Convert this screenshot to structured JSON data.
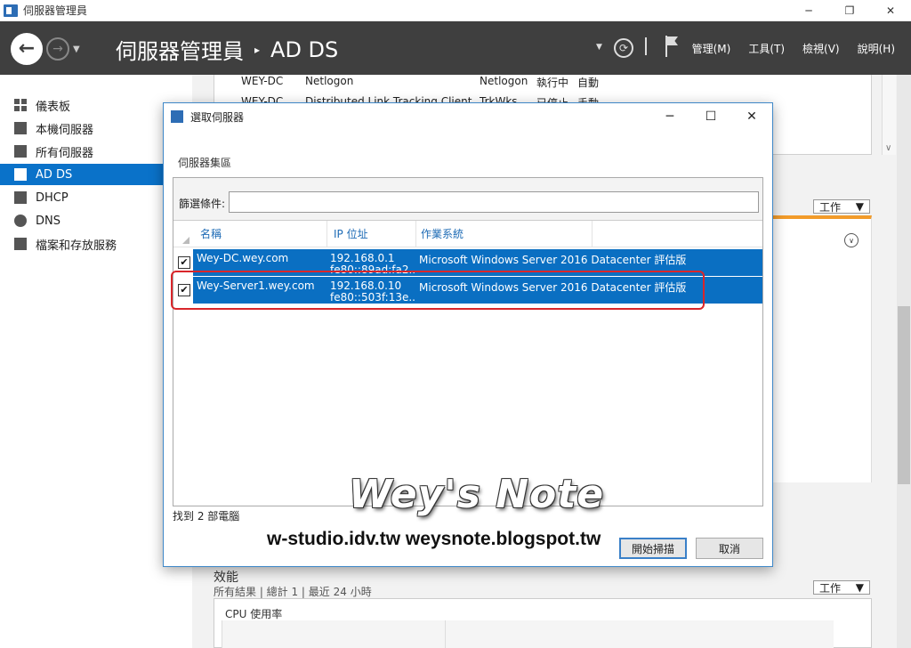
{
  "window": {
    "title": "伺服器管理員",
    "controls": [
      "─",
      "❐",
      "✕"
    ]
  },
  "header": {
    "breadcrumb_root": "伺服器管理員",
    "breadcrumb_sep": "▸",
    "breadcrumb_current": "AD DS",
    "menus": [
      "管理(M)",
      "工具(T)",
      "檢視(V)",
      "說明(H)"
    ]
  },
  "sidebar": {
    "items": [
      {
        "label": "儀表板",
        "icon": "dashboard-icon"
      },
      {
        "label": "本機伺服器",
        "icon": "server-icon"
      },
      {
        "label": "所有伺服器",
        "icon": "servers-icon"
      },
      {
        "label": "AD DS",
        "icon": "adds-icon",
        "active": true
      },
      {
        "label": "DHCP",
        "icon": "dhcp-icon"
      },
      {
        "label": "DNS",
        "icon": "dns-icon"
      },
      {
        "label": "檔案和存放服務",
        "icon": "storage-icon"
      }
    ]
  },
  "services": {
    "rows": [
      {
        "server": "WEY-DC",
        "display": "Netlogon",
        "service": "Netlogon",
        "status": "執行中",
        "start": "自動"
      },
      {
        "server": "WEY-DC",
        "display": "Distributed Link Tracking Client",
        "service": "TrkWks",
        "status": "已停止",
        "start": "手動"
      }
    ]
  },
  "tasks_label": "工作",
  "performance": {
    "title": "效能",
    "subtitle": "所有結果 | 總計 1 | 最近 24 小時",
    "cpu_label": "CPU 使用率"
  },
  "dialog": {
    "title": "選取伺服器",
    "pool_label": "伺服器集區",
    "filter_label": "篩選條件:",
    "filter_value": "",
    "columns": {
      "name": "名稱",
      "ip": "IP 位址",
      "os": "作業系統"
    },
    "rows": [
      {
        "checked": "✔",
        "name": "Wey-DC.wey.com",
        "ip1": "192.168.0.1",
        "ip2": "fe80::89ad:fa2...",
        "os": "Microsoft Windows Server 2016 Datacenter 評估版"
      },
      {
        "checked": "✔",
        "name": "Wey-Server1.wey.com",
        "ip1": "192.168.0.10",
        "ip2": "fe80::503f:13e...",
        "os": "Microsoft Windows Server 2016 Datacenter 評估版"
      }
    ],
    "found_text": "找到 2 部電腦",
    "scan_button": "開始掃描",
    "cancel_button": "取消"
  },
  "watermark": {
    "title": "Wey's Note",
    "urls": "w-studio.idv.tw  weysnote.blogspot.tw"
  },
  "colors": {
    "accent": "#0a6fc2",
    "header": "#3f3f3f",
    "highlight": "#d9262b",
    "tile_orange": "#f29b2a"
  }
}
